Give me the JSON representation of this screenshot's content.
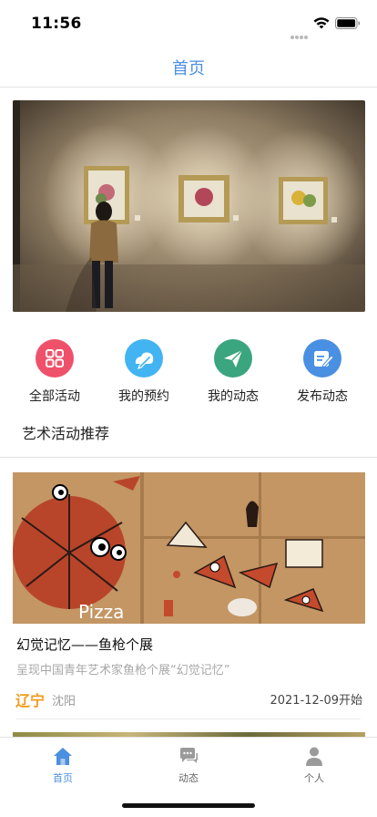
{
  "status_bar": {
    "time": "11:56"
  },
  "nav": {
    "title": "首页"
  },
  "quick_actions": [
    {
      "label": "全部活动",
      "icon": "grid-icon",
      "color": "#f0516a"
    },
    {
      "label": "我的预约",
      "icon": "cloud-pen-icon",
      "color": "#43b4f2"
    },
    {
      "label": "我的动态",
      "icon": "paper-plane-icon",
      "color": "#3aa57f"
    },
    {
      "label": "发布动态",
      "icon": "edit-icon",
      "color": "#4a90e2"
    }
  ],
  "section": {
    "title": "艺术活动推荐"
  },
  "activities": [
    {
      "title": "幻觉记忆——鱼枪个展",
      "description": "呈现中国青年艺术家鱼枪个展“幻觉记忆”",
      "province": "辽宁",
      "city": "沈阳",
      "date": "2021-12-09开始",
      "image_text": "Pizza"
    }
  ],
  "tab_bar": {
    "tabs": [
      {
        "label": "首页",
        "icon": "home-icon",
        "active": true
      },
      {
        "label": "动态",
        "icon": "chat-bubble-icon",
        "active": false
      },
      {
        "label": "个人",
        "icon": "person-icon",
        "active": false
      }
    ]
  },
  "colors": {
    "accent": "#4a8fe0",
    "location": "#f29b21"
  }
}
